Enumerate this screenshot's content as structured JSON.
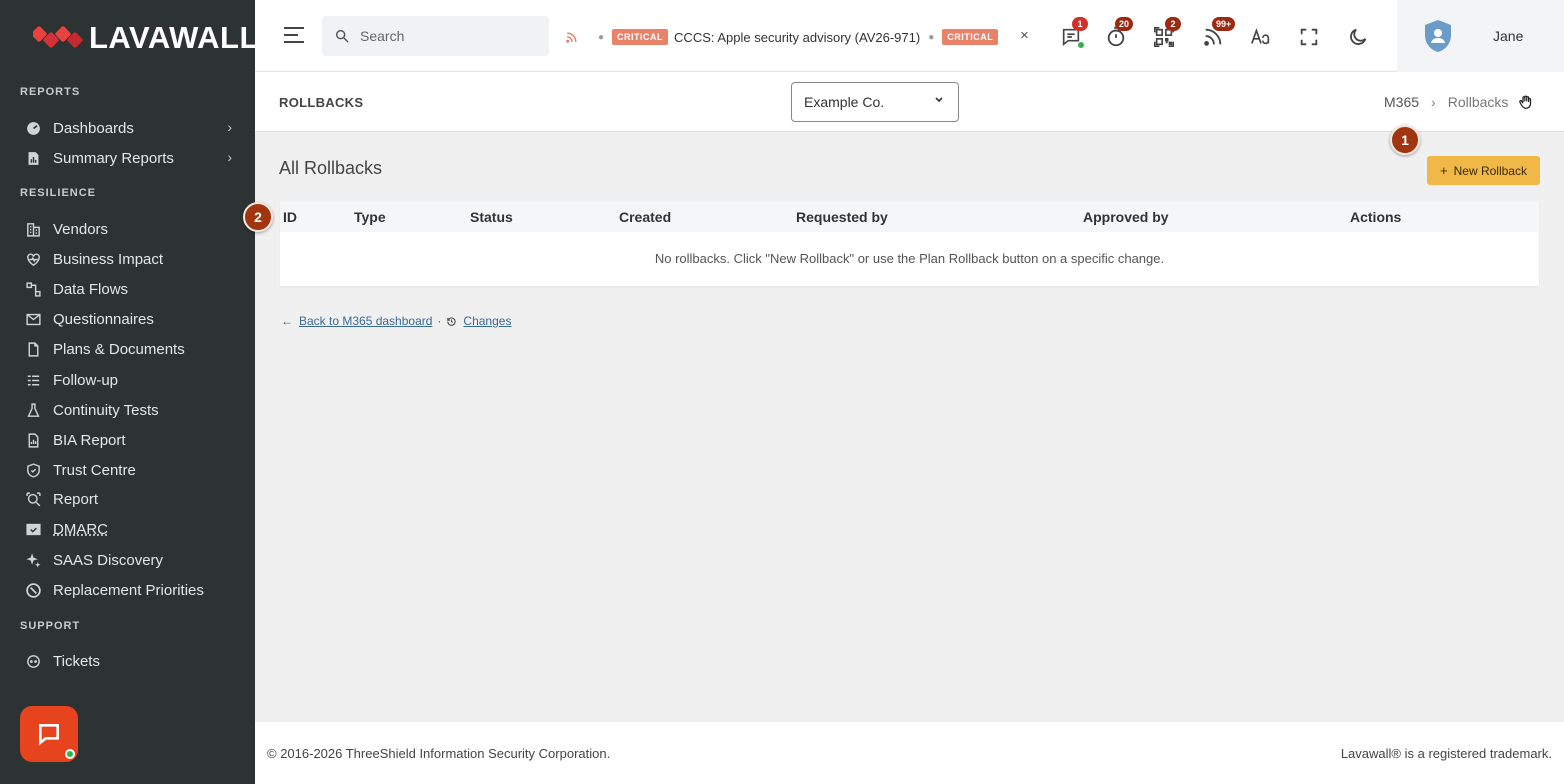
{
  "brand": {
    "name": "LAVAWALL",
    "reg": "®"
  },
  "sidebar": {
    "sections": [
      {
        "title": "REPORTS",
        "items": [
          {
            "label": "Dashboards",
            "icon": "dashboard-icon",
            "chevron": "›"
          },
          {
            "label": "Summary Reports",
            "icon": "report-icon",
            "chevron": "›"
          }
        ]
      },
      {
        "title": "RESILIENCE",
        "items": [
          {
            "label": "Vendors",
            "icon": "building-icon"
          },
          {
            "label": "Business Impact",
            "icon": "heart-pulse-icon"
          },
          {
            "label": "Data Flows",
            "icon": "flow-icon"
          },
          {
            "label": "Questionnaires",
            "icon": "mail-icon"
          },
          {
            "label": "Plans & Documents",
            "icon": "document-icon"
          },
          {
            "label": "Follow-up",
            "icon": "list-icon"
          },
          {
            "label": "Continuity Tests",
            "icon": "flask-icon"
          },
          {
            "label": "BIA Report",
            "icon": "chart-report-icon"
          },
          {
            "label": "Trust Centre",
            "icon": "shield-icon"
          },
          {
            "label": "Report",
            "icon": "search-report-icon"
          },
          {
            "label": "DMARC",
            "icon": "mail-check-icon"
          },
          {
            "label": "SAAS Discovery",
            "icon": "sparkle-icon"
          },
          {
            "label": "Replacement Priorities",
            "icon": "target-icon"
          }
        ]
      },
      {
        "title": "SUPPORT",
        "items": [
          {
            "label": "Tickets",
            "icon": "ticket-icon"
          }
        ]
      }
    ]
  },
  "topbar": {
    "search_placeholder": "Search",
    "ticker": {
      "badge": "CRITICAL",
      "text": "CCCS: Apple security advisory (AV26-971)",
      "badge2": "CRITICAL",
      "close": "×"
    },
    "icons": [
      {
        "name": "messages-icon",
        "badge": "1"
      },
      {
        "name": "timer-icon",
        "badge": "20"
      },
      {
        "name": "qr-icon",
        "badge": "2"
      },
      {
        "name": "feed-icon",
        "badge": "99+"
      },
      {
        "name": "font-size-icon",
        "badge": ""
      },
      {
        "name": "fullscreen-icon",
        "badge": ""
      },
      {
        "name": "dark-mode-icon",
        "badge": ""
      }
    ],
    "user": {
      "name": "Jane"
    }
  },
  "page": {
    "title": "ROLLBACKS",
    "company": "Example Co.",
    "breadcrumb": {
      "parent": "M365",
      "sep": "›",
      "current": "Rollbacks"
    },
    "content_title": "All Rollbacks",
    "new_button": "New Rollback",
    "table": {
      "columns": [
        "ID",
        "Type",
        "Status",
        "Created",
        "Requested by",
        "Approved by",
        "Actions"
      ],
      "empty_message": "No rollbacks. Click \"New Rollback\" or use the Plan Rollback button on a specific change."
    },
    "links": {
      "back": "Back to M365 dashboard",
      "changes": "Changes"
    },
    "steps": [
      "1",
      "2"
    ]
  },
  "footer": {
    "copyright": "© 2016-2026 ThreeShield Information Security Corporation.",
    "trademark": "Lavawall® is a registered trademark."
  },
  "colors": {
    "sidebar": "#2d3233",
    "accent": "#f0b947",
    "brand": "#e8431f",
    "step": "#a0350f"
  }
}
